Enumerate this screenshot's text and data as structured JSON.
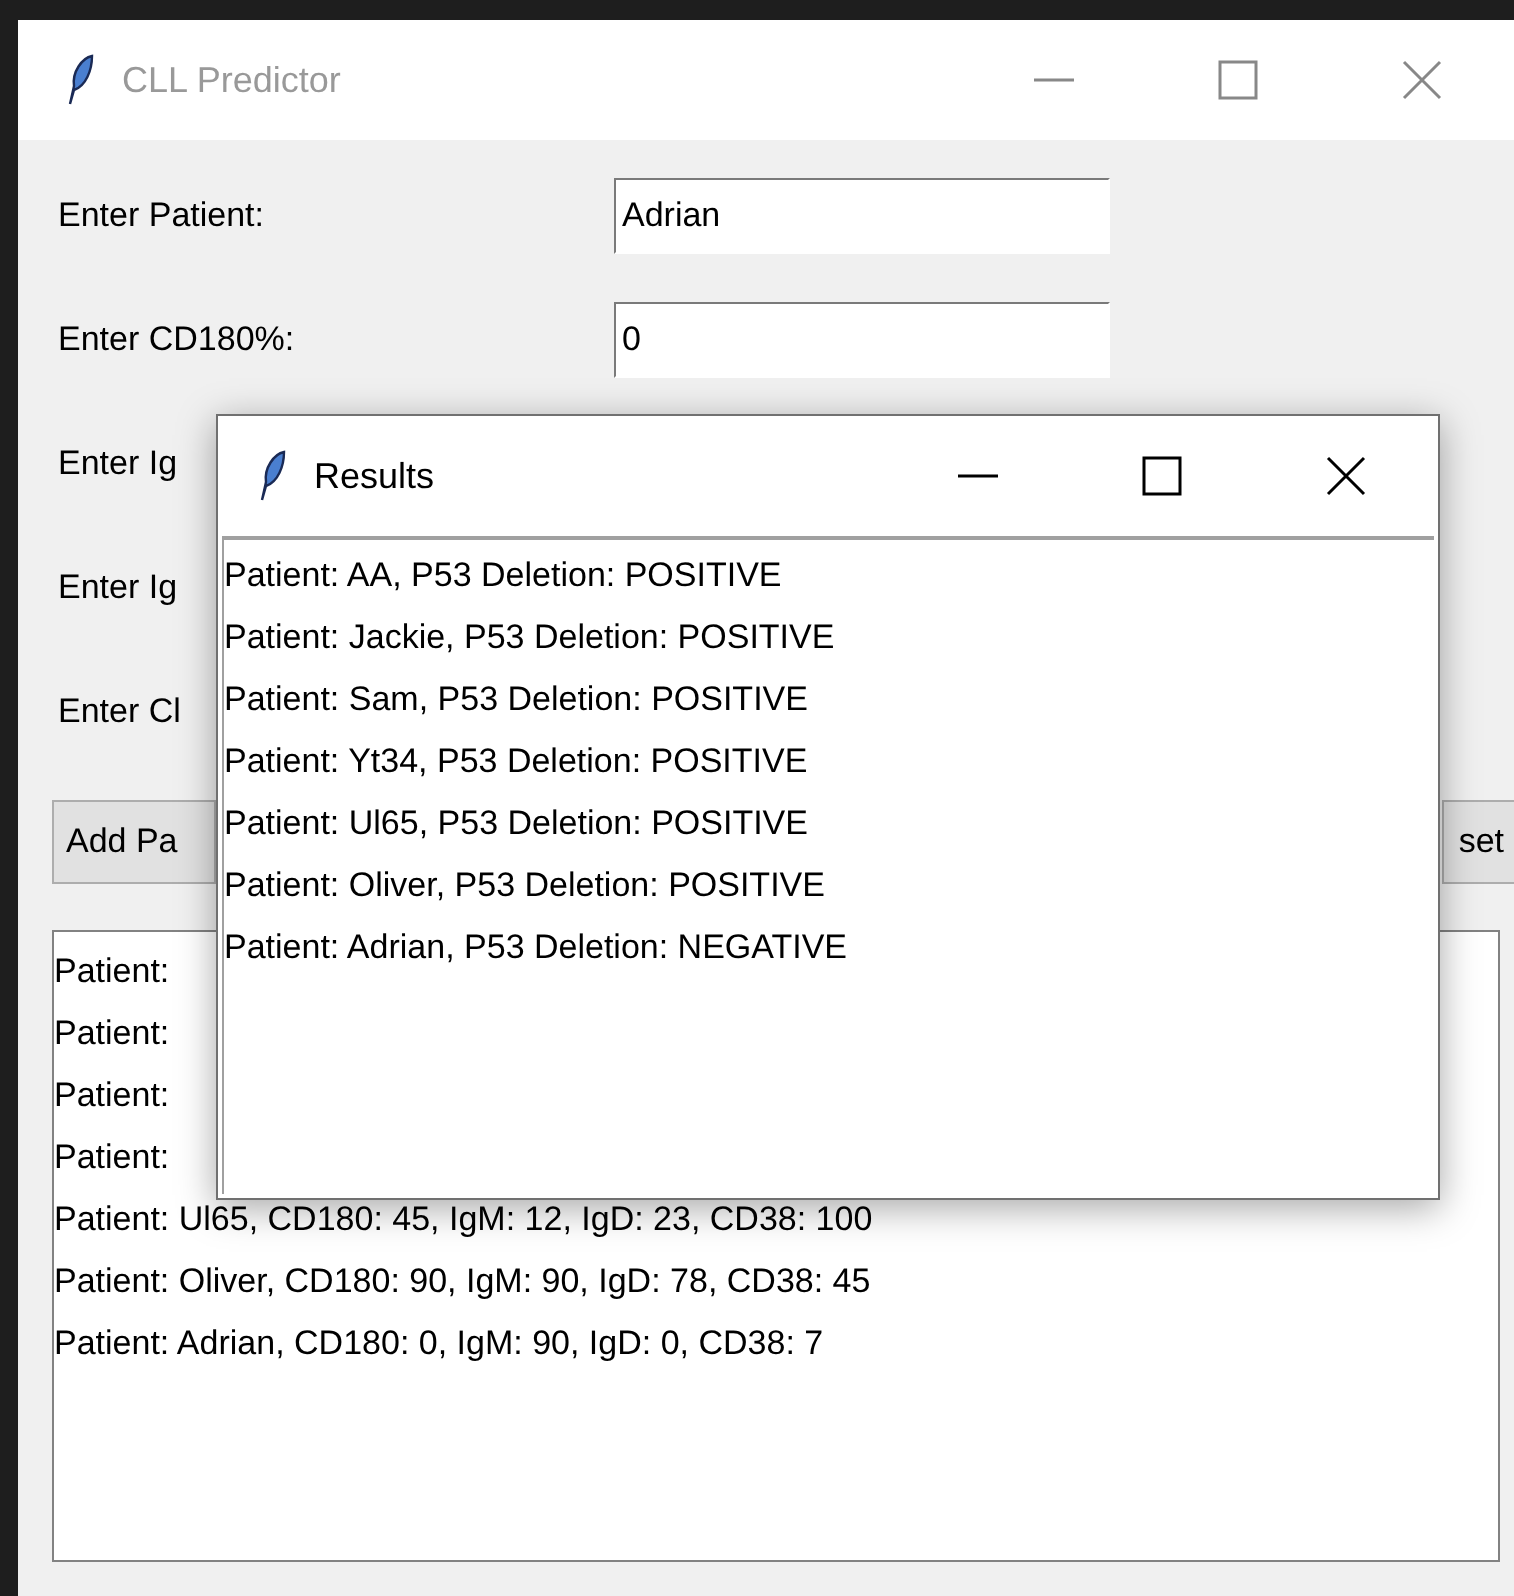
{
  "main_window": {
    "title": "CLL Predictor",
    "fields": [
      {
        "label": "Enter Patient:",
        "value": "Adrian"
      },
      {
        "label": "Enter CD180%:",
        "value": "0"
      },
      {
        "label": "Enter Ig"
      },
      {
        "label": "Enter Ig"
      },
      {
        "label": "Enter Cl"
      }
    ],
    "buttons": [
      "Add Pa",
      "set"
    ],
    "list": [
      "Patient:",
      "Patient:",
      "Patient:",
      "Patient:",
      "Patient: Ul65, CD180: 45, IgM: 12, IgD: 23, CD38: 100",
      "Patient: Oliver, CD180: 90, IgM: 90, IgD: 78, CD38: 45",
      "Patient: Adrian, CD180: 0, IgM: 90, IgD: 0, CD38: 7"
    ]
  },
  "results_window": {
    "title": "Results",
    "list": [
      "Patient: AA,  P53 Deletion: POSITIVE",
      "Patient: Jackie,  P53 Deletion: POSITIVE",
      "Patient: Sam,  P53 Deletion: POSITIVE",
      "Patient: Yt34,  P53 Deletion: POSITIVE",
      "Patient: Ul65,  P53 Deletion: POSITIVE",
      "Patient: Oliver,  P53 Deletion: POSITIVE",
      "Patient: Adrian,  P53 Deletion: NEGATIVE"
    ]
  }
}
